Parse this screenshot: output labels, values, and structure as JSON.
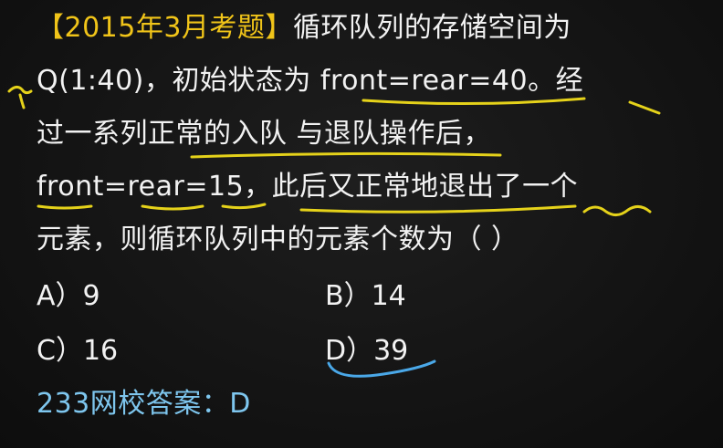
{
  "question": {
    "tag": "【2015年3月考题】",
    "line1_rest": "循环队列的存储空间为",
    "line2": "Q(1:40)，初始状态为 front=rear=40。经",
    "line3": "过一系列正常的入队 与退队操作后，",
    "line4": "front=rear=15，此后又正常地退出了一个",
    "line5": "元素，则循环队列中的元素个数为（        ）"
  },
  "options": {
    "a": "A）9",
    "b": "B）14",
    "c": "C）16",
    "d": "D）39"
  },
  "answer": {
    "text": "233网校答案：D"
  },
  "colors": {
    "tag": "#f0c419",
    "answer": "#7ec6ee",
    "text": "#f2f2f2",
    "ink_yellow": "#e5d21a",
    "ink_blue": "#4aa8e8"
  }
}
